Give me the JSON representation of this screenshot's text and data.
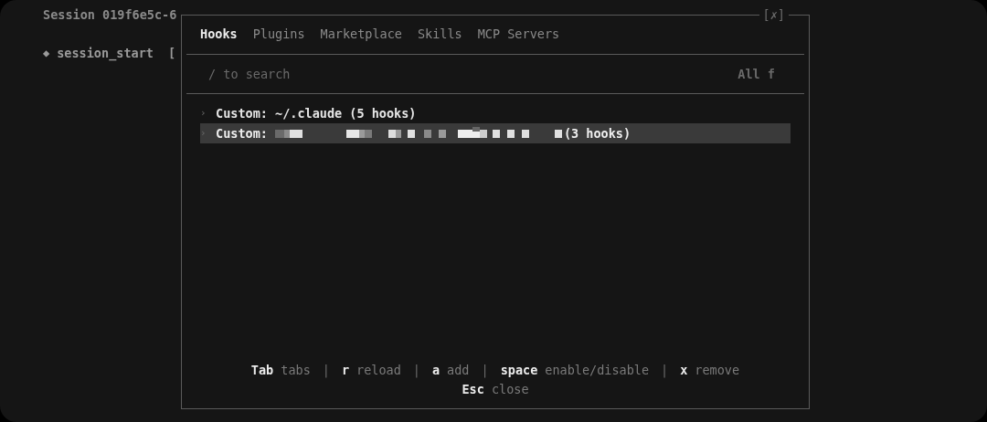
{
  "background": {
    "session_title": "Session 019f6e5c-6",
    "event": {
      "marker": "◆",
      "name": "session_start",
      "bracket": "["
    }
  },
  "dialog": {
    "close": "[✗]",
    "tabs": [
      {
        "label": "Hooks",
        "selected": true
      },
      {
        "label": "Plugins",
        "selected": false
      },
      {
        "label": "Marketplace",
        "selected": false
      },
      {
        "label": "Skills",
        "selected": false
      },
      {
        "label": "MCP Servers",
        "selected": false
      }
    ],
    "search": {
      "placeholder": "/ to search",
      "filter": "All f"
    },
    "groups": [
      {
        "chevron": "›",
        "label": "Custom: ~/.claude (5 hooks)",
        "selected": false
      },
      {
        "chevron": "›",
        "label": "Custom:",
        "redacted": true,
        "suffix": "(3 hooks)",
        "selected": true
      }
    ],
    "shortcut_lines": [
      [
        {
          "key": "Tab",
          "action": "tabs"
        },
        {
          "key": "r",
          "action": "reload"
        },
        {
          "key": "a",
          "action": "add"
        },
        {
          "key": "space",
          "action": "enable/disable"
        },
        {
          "key": "x",
          "action": "remove"
        }
      ],
      [
        {
          "key": "Esc",
          "action": "close"
        }
      ]
    ],
    "separator": "|"
  }
}
